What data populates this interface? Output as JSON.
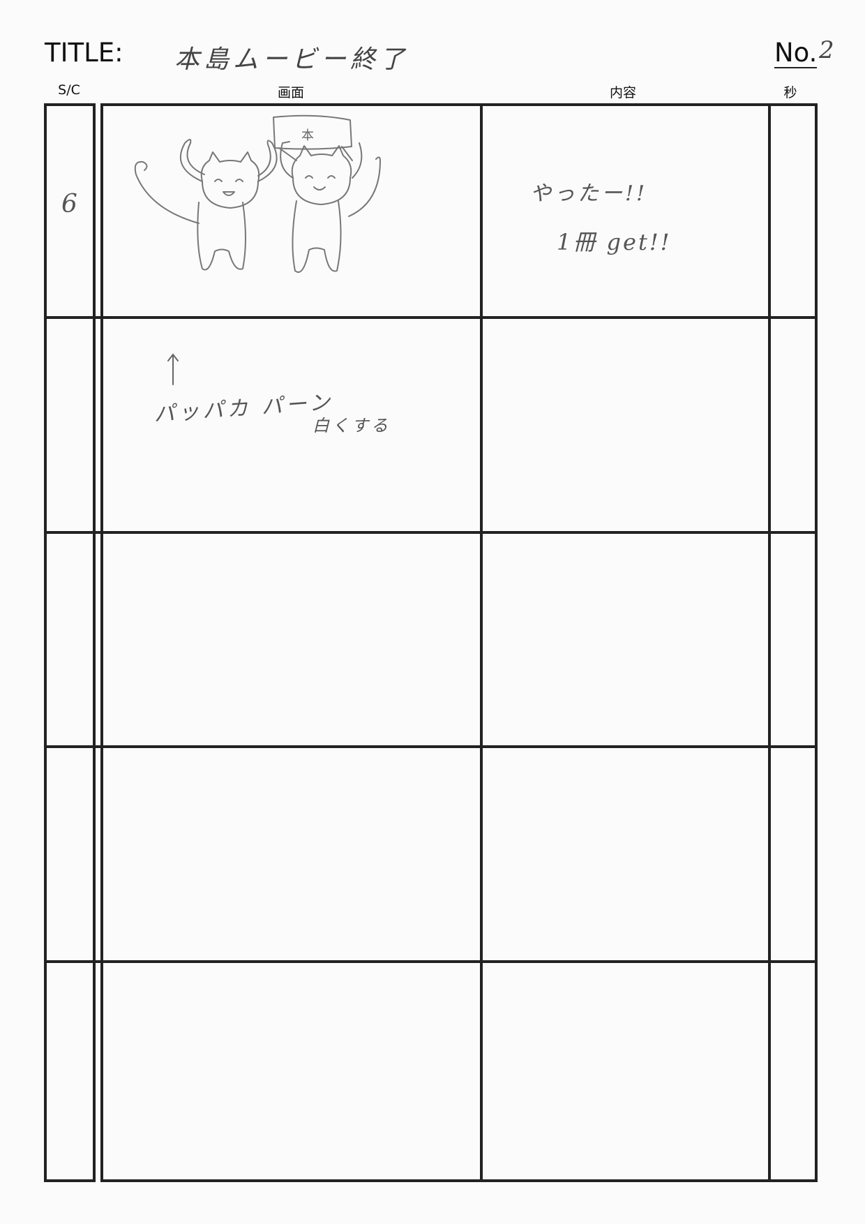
{
  "header": {
    "title_label": "TITLE:",
    "title_value": "本島ムービー終了",
    "number_label": "No.",
    "number_value": "2"
  },
  "columns": {
    "sc": "S/C",
    "screen": "画面",
    "content": "内容",
    "seconds": "秒"
  },
  "panels": [
    {
      "sc": "6",
      "screen_note": "パッパカ パーン",
      "screen_note_2": "白くする",
      "sign_text": "本",
      "content_lines": [
        "やったー!!",
        "1冊 get!!"
      ]
    }
  ],
  "colors": {
    "ink": "#222222",
    "pencil": "#555555",
    "paper": "#fbfbfb"
  }
}
